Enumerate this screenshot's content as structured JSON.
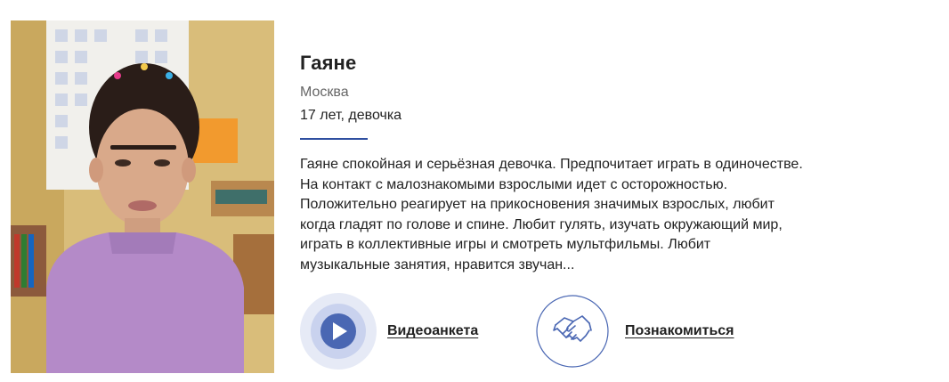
{
  "child": {
    "name": "Гаяне",
    "city": "Москва",
    "age_gender": "17 лет, девочка",
    "description_lines": [
      "Гаяне спокойная и серьёзная девочка. Предпочитает играть в одиночестве.",
      "На контакт с малознакомыми взрослыми идет с осторожностью.",
      "Положительно реагирует на прикосновения значимых взрослых, любит",
      "когда гладят по голове и спине. Любит гулять, изучать окружающий мир,",
      "играть в коллективные игры и смотреть мультфильмы. Любит",
      "музыкальные занятия, нравится звучан..."
    ]
  },
  "actions": {
    "video_label": "Видеоанкета",
    "meet_label": "Познакомиться"
  },
  "icons": {
    "video": "play-icon",
    "meet": "handshake-icon"
  },
  "colors": {
    "accent": "#2f4fa0",
    "icon_blue": "#4a67b3",
    "icon_circle_outer": "#e6eaf6",
    "icon_circle_inner": "#c9d2ee"
  }
}
